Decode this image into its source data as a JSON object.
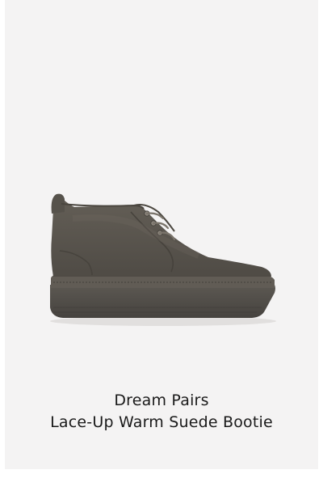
{
  "product": {
    "brand": "Dream Pairs",
    "title": "Lace-Up Warm Suede Bootie",
    "image_icon": "boot-product-image"
  },
  "colors": {
    "background": "#f4f3f3",
    "suede": "#5b5750",
    "sole": "#57534d",
    "text": "#1a1a1a"
  }
}
